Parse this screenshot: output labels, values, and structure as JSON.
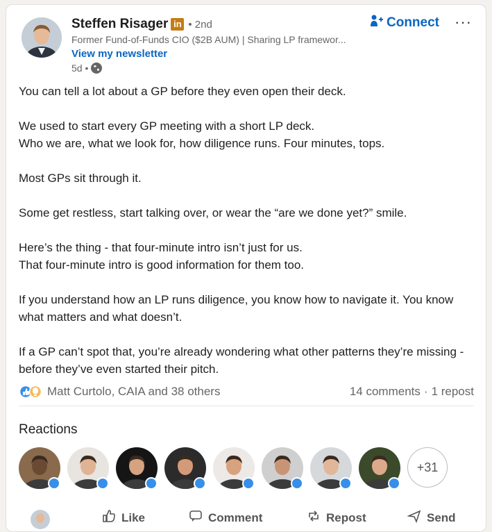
{
  "author": {
    "name": "Steffen Risager",
    "badge": "in",
    "degree": "• 2nd",
    "headline": "Former Fund-of-Funds CIO ($2B AUM) | Sharing LP framewor...",
    "newsletter": "View my newsletter",
    "time": "5d •"
  },
  "header_actions": {
    "connect": "Connect",
    "more": "···"
  },
  "post": {
    "paragraphs": [
      "You can tell a lot about a GP before they even open their deck.",
      "We used to start every GP meeting with a short LP deck.\nWho we are, what we look for, how diligence runs. Four minutes, tops.",
      "Most GPs sit through it.",
      "Some get restless, start talking over, or wear the “are we done yet?” smile.",
      "Here’s the thing - that four-minute intro isn’t just for us.\nThat four-minute intro is good information for them too.",
      "If you understand how an LP runs diligence, you know how to navigate it. You know what matters and what doesn’t.",
      "If a GP can’t spot that, you’re already wondering what other patterns they’re missing - before they’ve even started their pitch."
    ]
  },
  "social": {
    "reactors": "Matt Curtolo, CAIA and 38 others",
    "comments": "14 comments",
    "separator": "·",
    "reposts": "1 repost"
  },
  "reactions": {
    "title": "Reactions",
    "more_count": "+31",
    "avatars": [
      {
        "bg": "#8a6a4c",
        "face": "#6b4a33"
      },
      {
        "bg": "#e8e4df",
        "face": "#e0b394"
      },
      {
        "bg": "#151515",
        "face": "#d7a27f"
      },
      {
        "bg": "#2b2b2b",
        "face": "#d39a7a"
      },
      {
        "bg": "#ece9e6",
        "face": "#d9a27e"
      },
      {
        "bg": "#cfcfcf",
        "face": "#c99476"
      },
      {
        "bg": "#d6d9dc",
        "face": "#e1b79a"
      },
      {
        "bg": "#3a4a2a",
        "face": "#dca98a"
      }
    ]
  },
  "actions": [
    "Like",
    "Comment",
    "Repost",
    "Send"
  ],
  "colors": {
    "accent": "#0a66c2",
    "like_blue": "#378fe9",
    "brand_badge": "#c37d16"
  }
}
